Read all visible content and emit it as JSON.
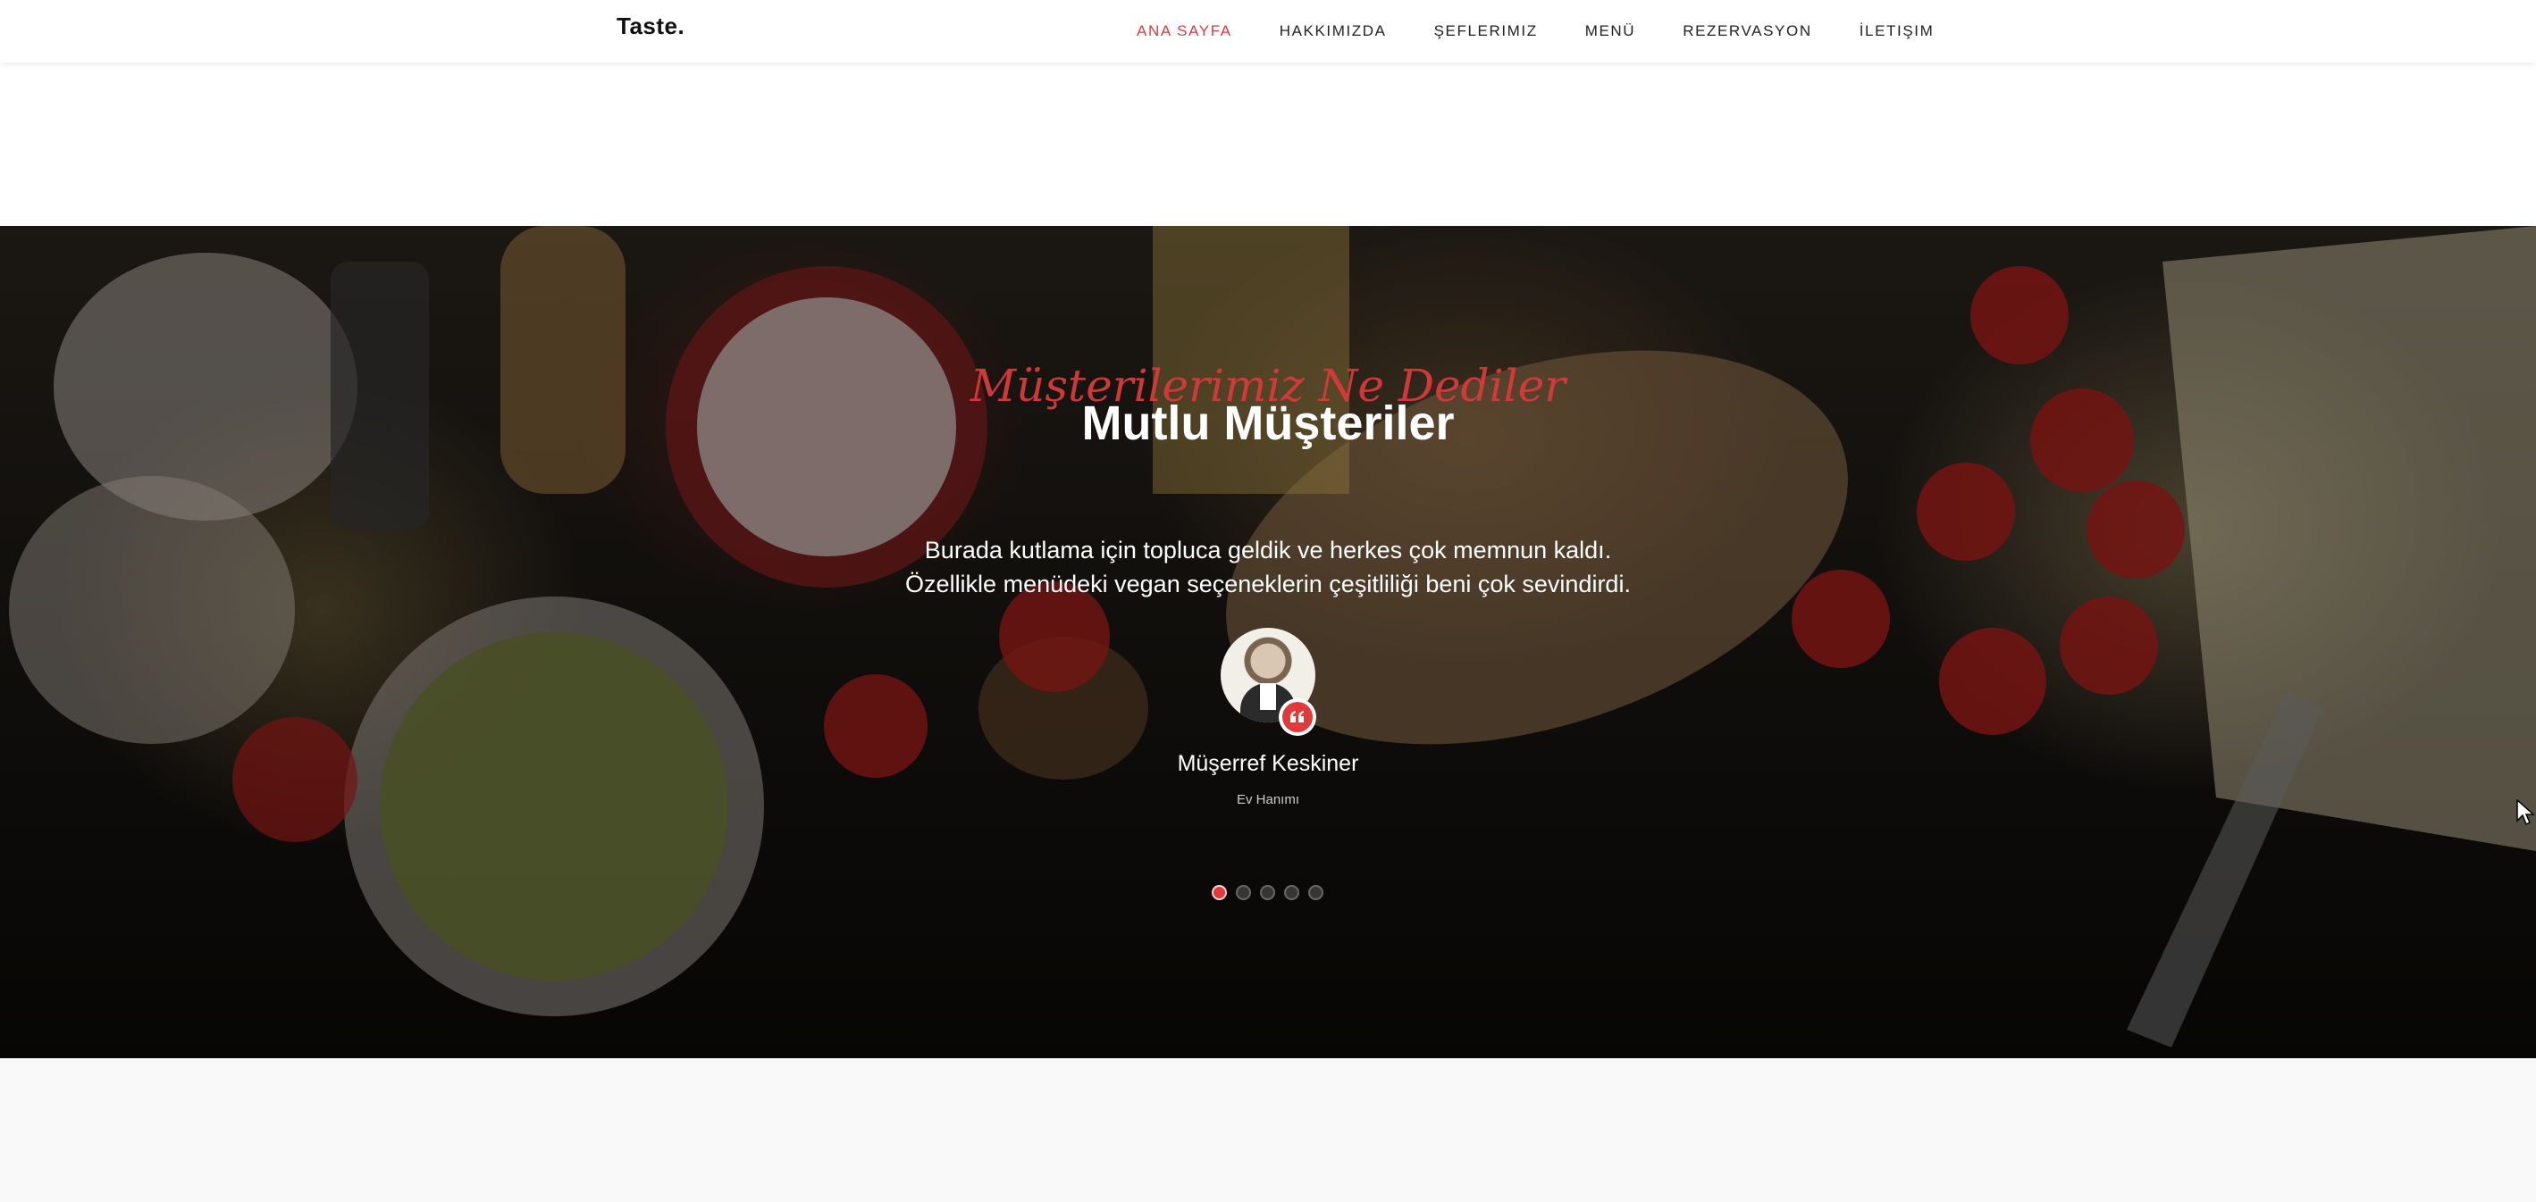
{
  "navbar": {
    "brand": "Taste.",
    "links": [
      {
        "label": "ANA SAYFA",
        "active": true
      },
      {
        "label": "HAKKIMIZDA",
        "active": false
      },
      {
        "label": "ŞEFLERIMIZ",
        "active": false
      },
      {
        "label": "MENÜ",
        "active": false
      },
      {
        "label": "REZERVASYON",
        "active": false
      },
      {
        "label": "İLETIŞIM",
        "active": false
      }
    ]
  },
  "testimonials": {
    "subtitle": "Müşterilerimiz Ne Dediler",
    "title": "Mutlu Müşteriler",
    "quote_line1": "Burada kutlama için topluca geldik ve herkes çok memnun kaldı.",
    "quote_line2": "Özellikle menüdeki vegan seçeneklerin çeşitliliği beni çok sevindirdi.",
    "author_name": "Müşerref Keskiner",
    "author_role": "Ev Hanımı",
    "slide_count": 5,
    "active_slide": 1
  },
  "colors": {
    "accent": "#e03a3a",
    "nav_text": "#222222",
    "hero_text": "#ffffff",
    "below_bg": "#f9f9f9"
  },
  "icons": {
    "quote_badge": "quote-left-icon",
    "cursor": "mouse-pointer-icon"
  }
}
